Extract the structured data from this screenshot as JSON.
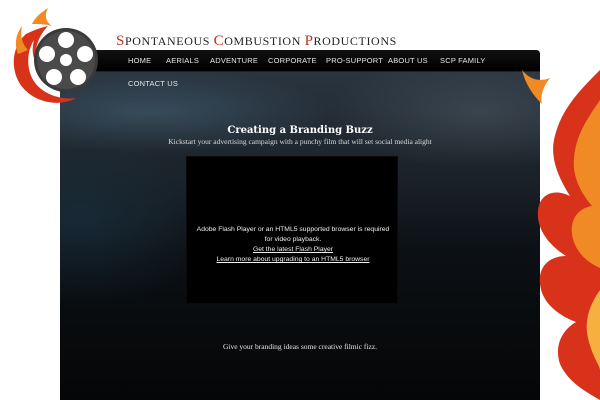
{
  "site": {
    "title_parts": [
      {
        "cap": "S",
        "rest": "pontaneous "
      },
      {
        "cap": "C",
        "rest": "ombustion "
      },
      {
        "cap": "P",
        "rest": "roductions"
      }
    ]
  },
  "nav": {
    "items": [
      "HOME",
      "AERIALS",
      "ADVENTURE",
      "CORPORATE",
      "PRO-SUPPORT",
      "ABOUT US",
      "SCP FAMILY"
    ],
    "contact": "CONTACT US"
  },
  "hero": {
    "headline": "Creating a Branding Buzz",
    "subhead": "Kickstart your advertising campaign with a punchy film that will set social media alight"
  },
  "video": {
    "message_line1": "Adobe Flash Player or an HTML5 supported browser is required",
    "message_line2": "for video playback.",
    "link_flash": "Get the latest Flash Player",
    "link_html5": "Learn more about upgrading to an HTML5 browser"
  },
  "footer": {
    "tagline": "Give your branding ideas some creative filmic fizz."
  },
  "icons": {
    "logo": "film-reel-flame-logo-icon",
    "decor": "flames-decoration-icon"
  },
  "colors": {
    "accent": "#b8321e",
    "flame_red": "#d8321b",
    "flame_orange": "#f08a24",
    "background": "#000000"
  }
}
